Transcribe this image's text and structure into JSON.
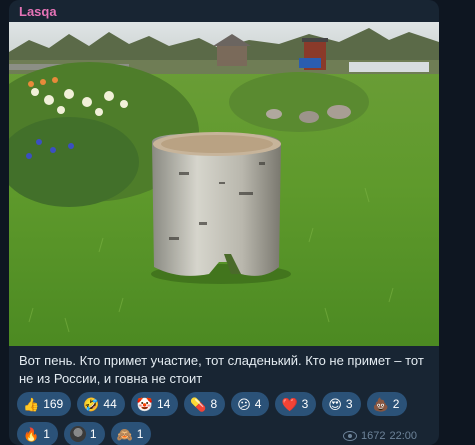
{
  "message": {
    "sender": "Lasqa",
    "caption": "Вот пень. Кто примет участие, тот сладенький. Кто не примет – тот не из России, и говна не стоит",
    "views": "1672",
    "time": "22:00"
  },
  "reactions": [
    {
      "emoji": "👍",
      "count": "169"
    },
    {
      "emoji": "🤣",
      "count": "44"
    },
    {
      "emoji": "🤡",
      "count": "14"
    },
    {
      "emoji": "💊",
      "count": "8"
    },
    {
      "emoji": "😕",
      "count": "4"
    },
    {
      "emoji": "❤️",
      "count": "3"
    },
    {
      "emoji": "😍",
      "count": "3"
    },
    {
      "emoji": "💩",
      "count": "2"
    },
    {
      "emoji": "🔥",
      "count": "1"
    },
    {
      "emoji": "",
      "count": "1"
    },
    {
      "emoji": "🙈",
      "count": "1"
    }
  ],
  "colors": {
    "background": "#0e1621",
    "bubble": "#182533",
    "sender": "#e573b6",
    "reaction_chip": "#2b5278"
  }
}
